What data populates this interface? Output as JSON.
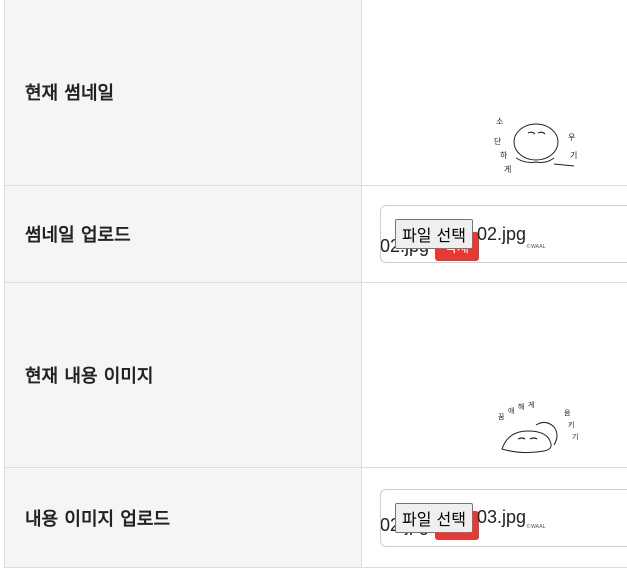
{
  "rows": {
    "current_thumbnail": {
      "label": "현재 썸네일",
      "file_name": "02.jpg",
      "delete_label": "삭제",
      "credit": "©WAAL"
    },
    "thumbnail_upload": {
      "label": "썸네일 업로드",
      "choose_label": "파일 선택",
      "file_name": "02.jpg"
    },
    "current_content_image": {
      "label": "현재 내용 이미지",
      "file_name": "02.jpg",
      "delete_label": "삭제",
      "credit": "©WAAL"
    },
    "content_image_upload": {
      "label": "내용 이미지 업로드",
      "choose_label": "파일 선택",
      "file_name": "03.jpg"
    }
  },
  "colors": {
    "label_bg": "#f5f5f5",
    "delete_bg": "#e53935",
    "border": "#dddddd"
  }
}
